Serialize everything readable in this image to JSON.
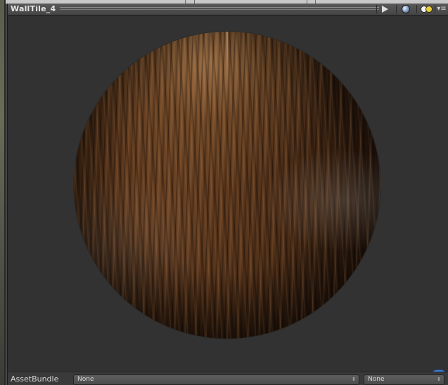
{
  "window": {
    "title": "WallTile_4"
  },
  "toolbar": {
    "play_icon": "play-icon",
    "sphere_icon": "preview-sphere-icon",
    "lights_icon": "preview-lights-icon",
    "menu_glyph": "▾≡"
  },
  "preview": {
    "material": "wood bark texture sphere"
  },
  "tag_icon": "tag-icon",
  "asset_bundle": {
    "label": "AssetBundle",
    "name_value": "None",
    "variant_value": "None",
    "arrow_glyph": "⇕"
  },
  "colors": {
    "accent_blue": "#3f7fd6",
    "panel_bg": "#323232",
    "titlebar": "#454545"
  }
}
